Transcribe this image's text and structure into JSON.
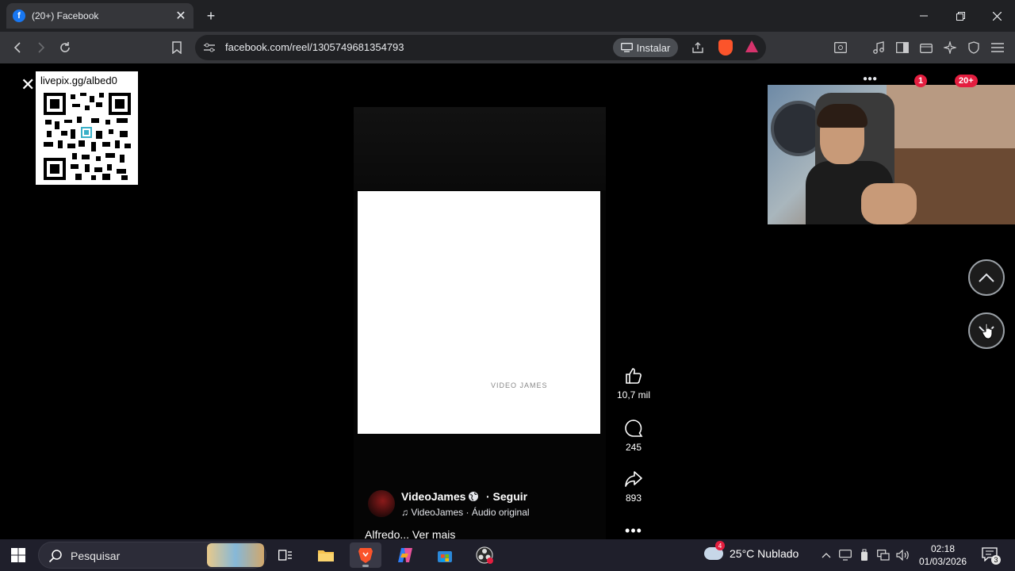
{
  "browser": {
    "tab_title": "(20+) Facebook",
    "tab_favicon": "f",
    "url": "facebook.com/reel/1305749681354793",
    "install_label": "Instalar"
  },
  "overlay": {
    "qr_url": "livepix.gg/albed0"
  },
  "header_badges": {
    "notifications": "1",
    "messages": "20+"
  },
  "reel": {
    "watermark": "VIDEO JAMES",
    "likes": "10,7 mil",
    "comments": "245",
    "shares": "893",
    "more": "•••",
    "author": "VideoJames",
    "follow": "· Seguir",
    "audio": "VideoJames · Áudio original",
    "caption": "Alfredo... Ver mais"
  },
  "taskbar": {
    "search_placeholder": "Pesquisar",
    "weather_badge": "4",
    "weather": "25°C  Nublado",
    "time": "02:18",
    "date": "01/03/2026",
    "notifications_count": "3"
  },
  "colors": {
    "facebook_blue": "#1877f2",
    "badge_red": "#e41e3f",
    "brave_orange": "#fb542b"
  }
}
